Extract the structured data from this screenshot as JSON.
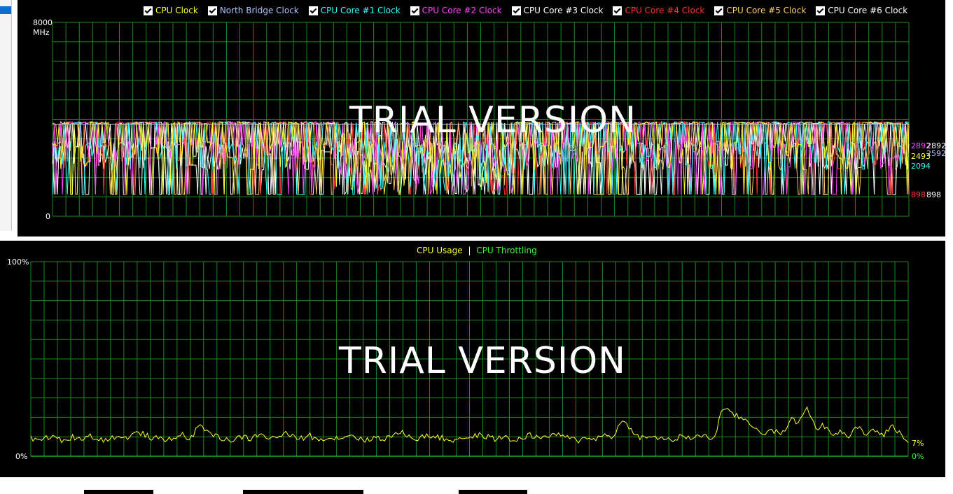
{
  "top_chart": {
    "legend": [
      {
        "label": "CPU Clock",
        "color": "#ffff33"
      },
      {
        "label": "North Bridge Clock",
        "color": "#b0c4ff"
      },
      {
        "label": "CPU Core #1 Clock",
        "color": "#33ffff"
      },
      {
        "label": "CPU Core #2 Clock",
        "color": "#ff44ff"
      },
      {
        "label": "CPU Core #3 Clock",
        "color": "#ffffff"
      },
      {
        "label": "CPU Core #4 Clock",
        "color": "#ff3333"
      },
      {
        "label": "CPU Core #5 Clock",
        "color": "#ffcc66"
      },
      {
        "label": "CPU Core #6 Clock",
        "color": "#ffffff"
      }
    ],
    "y_max": "8000",
    "y_unit": "MHz",
    "y_min": "0",
    "watermark": "TRIAL VERSION",
    "current_values": [
      {
        "text": "2892",
        "color": "#ff44ff"
      },
      {
        "text": "2892",
        "color": "#ffffff"
      },
      {
        "text": "2592",
        "color": "#b0c4ff"
      },
      {
        "text": "2493",
        "color": "#ffff33"
      },
      {
        "text": "2094",
        "color": "#33ffff"
      },
      {
        "text": "898",
        "color": "#ff3333"
      },
      {
        "text": "898",
        "color": "#ffffff"
      }
    ]
  },
  "bottom_chart": {
    "legend_usage": "CPU Usage",
    "legend_sep": "|",
    "legend_throttle": "CPU Throttling",
    "usage_color": "#ffff33",
    "throttle_color": "#33ff33",
    "y_max": "100%",
    "y_min": "0%",
    "watermark": "TRIAL VERSION",
    "usage_value": "7%",
    "throttle_value": "0%"
  },
  "chart_data": [
    {
      "type": "line",
      "title": "",
      "ylim": [
        0,
        8000
      ],
      "ylabel": "MHz",
      "series": [
        {
          "name": "CPU Clock",
          "latest": 2493
        },
        {
          "name": "North Bridge Clock",
          "latest": 2592
        },
        {
          "name": "CPU Core #1 Clock",
          "latest": 2094
        },
        {
          "name": "CPU Core #2 Clock",
          "latest": 2892
        },
        {
          "name": "CPU Core #3 Clock",
          "latest": 2892
        },
        {
          "name": "CPU Core #4 Clock",
          "latest": 898
        },
        {
          "name": "CPU Core #5 Clock",
          "latest": 898
        },
        {
          "name": "CPU Core #6 Clock",
          "latest": 898
        }
      ],
      "typical_range": [
        800,
        3900
      ]
    },
    {
      "type": "line",
      "title": "",
      "ylim": [
        0,
        100
      ],
      "series": [
        {
          "name": "CPU Usage",
          "latest": 7,
          "values": [
            9,
            8,
            10,
            9,
            8,
            10,
            9,
            11,
            8,
            9,
            10,
            9,
            11,
            12,
            10,
            9,
            8,
            10,
            11,
            9,
            16,
            13,
            10,
            9,
            8,
            10,
            9,
            11,
            10,
            9,
            12,
            10,
            9,
            11,
            8,
            10,
            9,
            10,
            11,
            9,
            8,
            10,
            9,
            11,
            12,
            10,
            9,
            11,
            10,
            9,
            8,
            10,
            9,
            11,
            10,
            9,
            10,
            8,
            9,
            11,
            10,
            9,
            12,
            10,
            9,
            8,
            10,
            9,
            11,
            10,
            18,
            15,
            10,
            9,
            10,
            9,
            8,
            10,
            9,
            11,
            10,
            9,
            25,
            22,
            20,
            18,
            14,
            12,
            13,
            11,
            19,
            17,
            26,
            14,
            16,
            12,
            13,
            10,
            15,
            11,
            14,
            10,
            16,
            12,
            7
          ]
        },
        {
          "name": "CPU Throttling",
          "latest": 0
        }
      ]
    }
  ]
}
